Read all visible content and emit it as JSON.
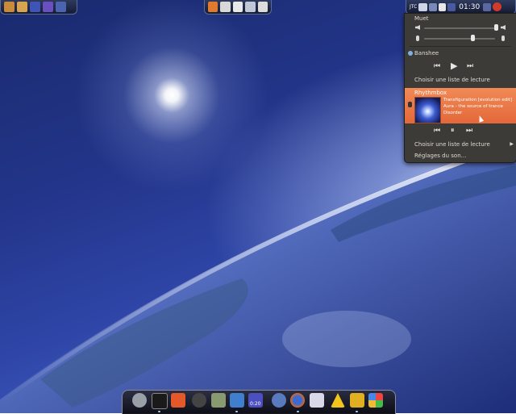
{
  "top_panel": {
    "clock": "01:30",
    "indicator_label": "JTC"
  },
  "sound_menu": {
    "mute_label": "Muet",
    "banshee": {
      "name": "Banshee",
      "playlist_label": "Choisir une liste de lecture"
    },
    "rhythmbox": {
      "name": "Rhythmbox",
      "track_title": "Transfiguration [evolution edit]",
      "track_artist": "Aura - the source of trance",
      "track_album": "Disorder",
      "playlist_label": "Choisir une liste de lecture"
    },
    "settings_label": "Réglages du son..."
  },
  "dock": {
    "clock_badge": "0:20"
  },
  "colors": {
    "menu_bg": "#3c3b37",
    "highlight": "#e96c3e",
    "panel_bg": "#1b213c"
  }
}
